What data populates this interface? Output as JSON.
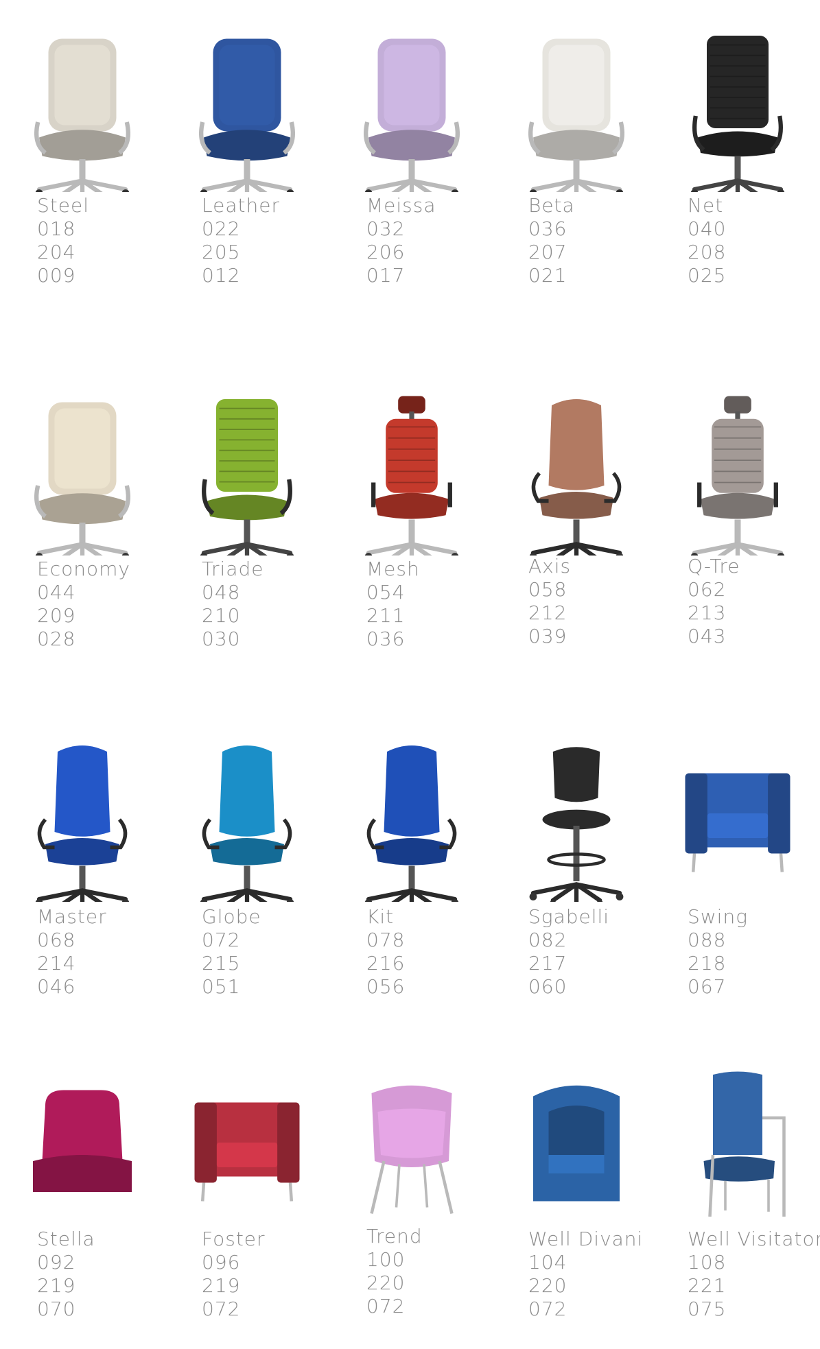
{
  "catalog": {
    "items": [
      {
        "name": "Steel",
        "codes": [
          "018",
          "204",
          "009"
        ],
        "icon": "executive-chair-icon",
        "color": "#d8d3c8"
      },
      {
        "name": "Leather",
        "codes": [
          "022",
          "205",
          "012"
        ],
        "icon": "executive-chair-icon",
        "color": "#2f56a0"
      },
      {
        "name": "Meissa",
        "codes": [
          "032",
          "206",
          "017"
        ],
        "icon": "executive-chair-icon",
        "color": "#c3aed8"
      },
      {
        "name": "Beta",
        "codes": [
          "036",
          "207",
          "021"
        ],
        "icon": "executive-chair-icon",
        "color": "#e6e4de"
      },
      {
        "name": "Net",
        "codes": [
          "040",
          "208",
          "025"
        ],
        "icon": "mesh-chair-icon",
        "color": "#262626"
      },
      {
        "name": "Economy",
        "codes": [
          "044",
          "209",
          "028"
        ],
        "icon": "executive-chair-icon",
        "color": "#e2d8c4"
      },
      {
        "name": "Triade",
        "codes": [
          "048",
          "210",
          "030"
        ],
        "icon": "mesh-chair-icon",
        "color": "#86b230"
      },
      {
        "name": "Mesh",
        "codes": [
          "054",
          "211",
          "036"
        ],
        "icon": "headrest-chair-icon",
        "color": "#c43a2c"
      },
      {
        "name": "Axis",
        "codes": [
          "058",
          "212",
          "039"
        ],
        "icon": "task-chair-icon",
        "color": "#b27a62"
      },
      {
        "name": "Q-Tre",
        "codes": [
          "062",
          "213",
          "043"
        ],
        "icon": "headrest-chair-icon",
        "color": "#a39a96"
      },
      {
        "name": "Master",
        "codes": [
          "068",
          "214",
          "046"
        ],
        "icon": "task-chair-icon",
        "color": "#2457c8"
      },
      {
        "name": "Globe",
        "codes": [
          "072",
          "215",
          "051"
        ],
        "icon": "task-chair-icon",
        "color": "#1b8fc8"
      },
      {
        "name": "Kit",
        "codes": [
          "078",
          "216",
          "056"
        ],
        "icon": "task-chair-icon",
        "color": "#1f50b8"
      },
      {
        "name": "Sgabelli",
        "codes": [
          "082",
          "217",
          "060"
        ],
        "icon": "stool-icon",
        "color": "#2a2a2a"
      },
      {
        "name": "Swing",
        "codes": [
          "088",
          "218",
          "067"
        ],
        "icon": "armchair-icon",
        "color": "#2e5fb3"
      },
      {
        "name": "Stella",
        "codes": [
          "092",
          "219",
          "070"
        ],
        "icon": "lounge-seat-icon",
        "color": "#b01b5a"
      },
      {
        "name": "Foster",
        "codes": [
          "096",
          "219",
          "072"
        ],
        "icon": "armchair-icon",
        "color": "#b83040"
      },
      {
        "name": "Trend",
        "codes": [
          "100",
          "220",
          "072"
        ],
        "icon": "shell-chair-icon",
        "color": "#d69ad6"
      },
      {
        "name": "Well Divani",
        "codes": [
          "104",
          "220",
          "072"
        ],
        "icon": "tub-chair-icon",
        "color": "#2b63a6"
      },
      {
        "name": "Well Visitator",
        "codes": [
          "108",
          "221",
          "075"
        ],
        "icon": "visitor-chair-icon",
        "color": "#3366a8"
      }
    ]
  }
}
